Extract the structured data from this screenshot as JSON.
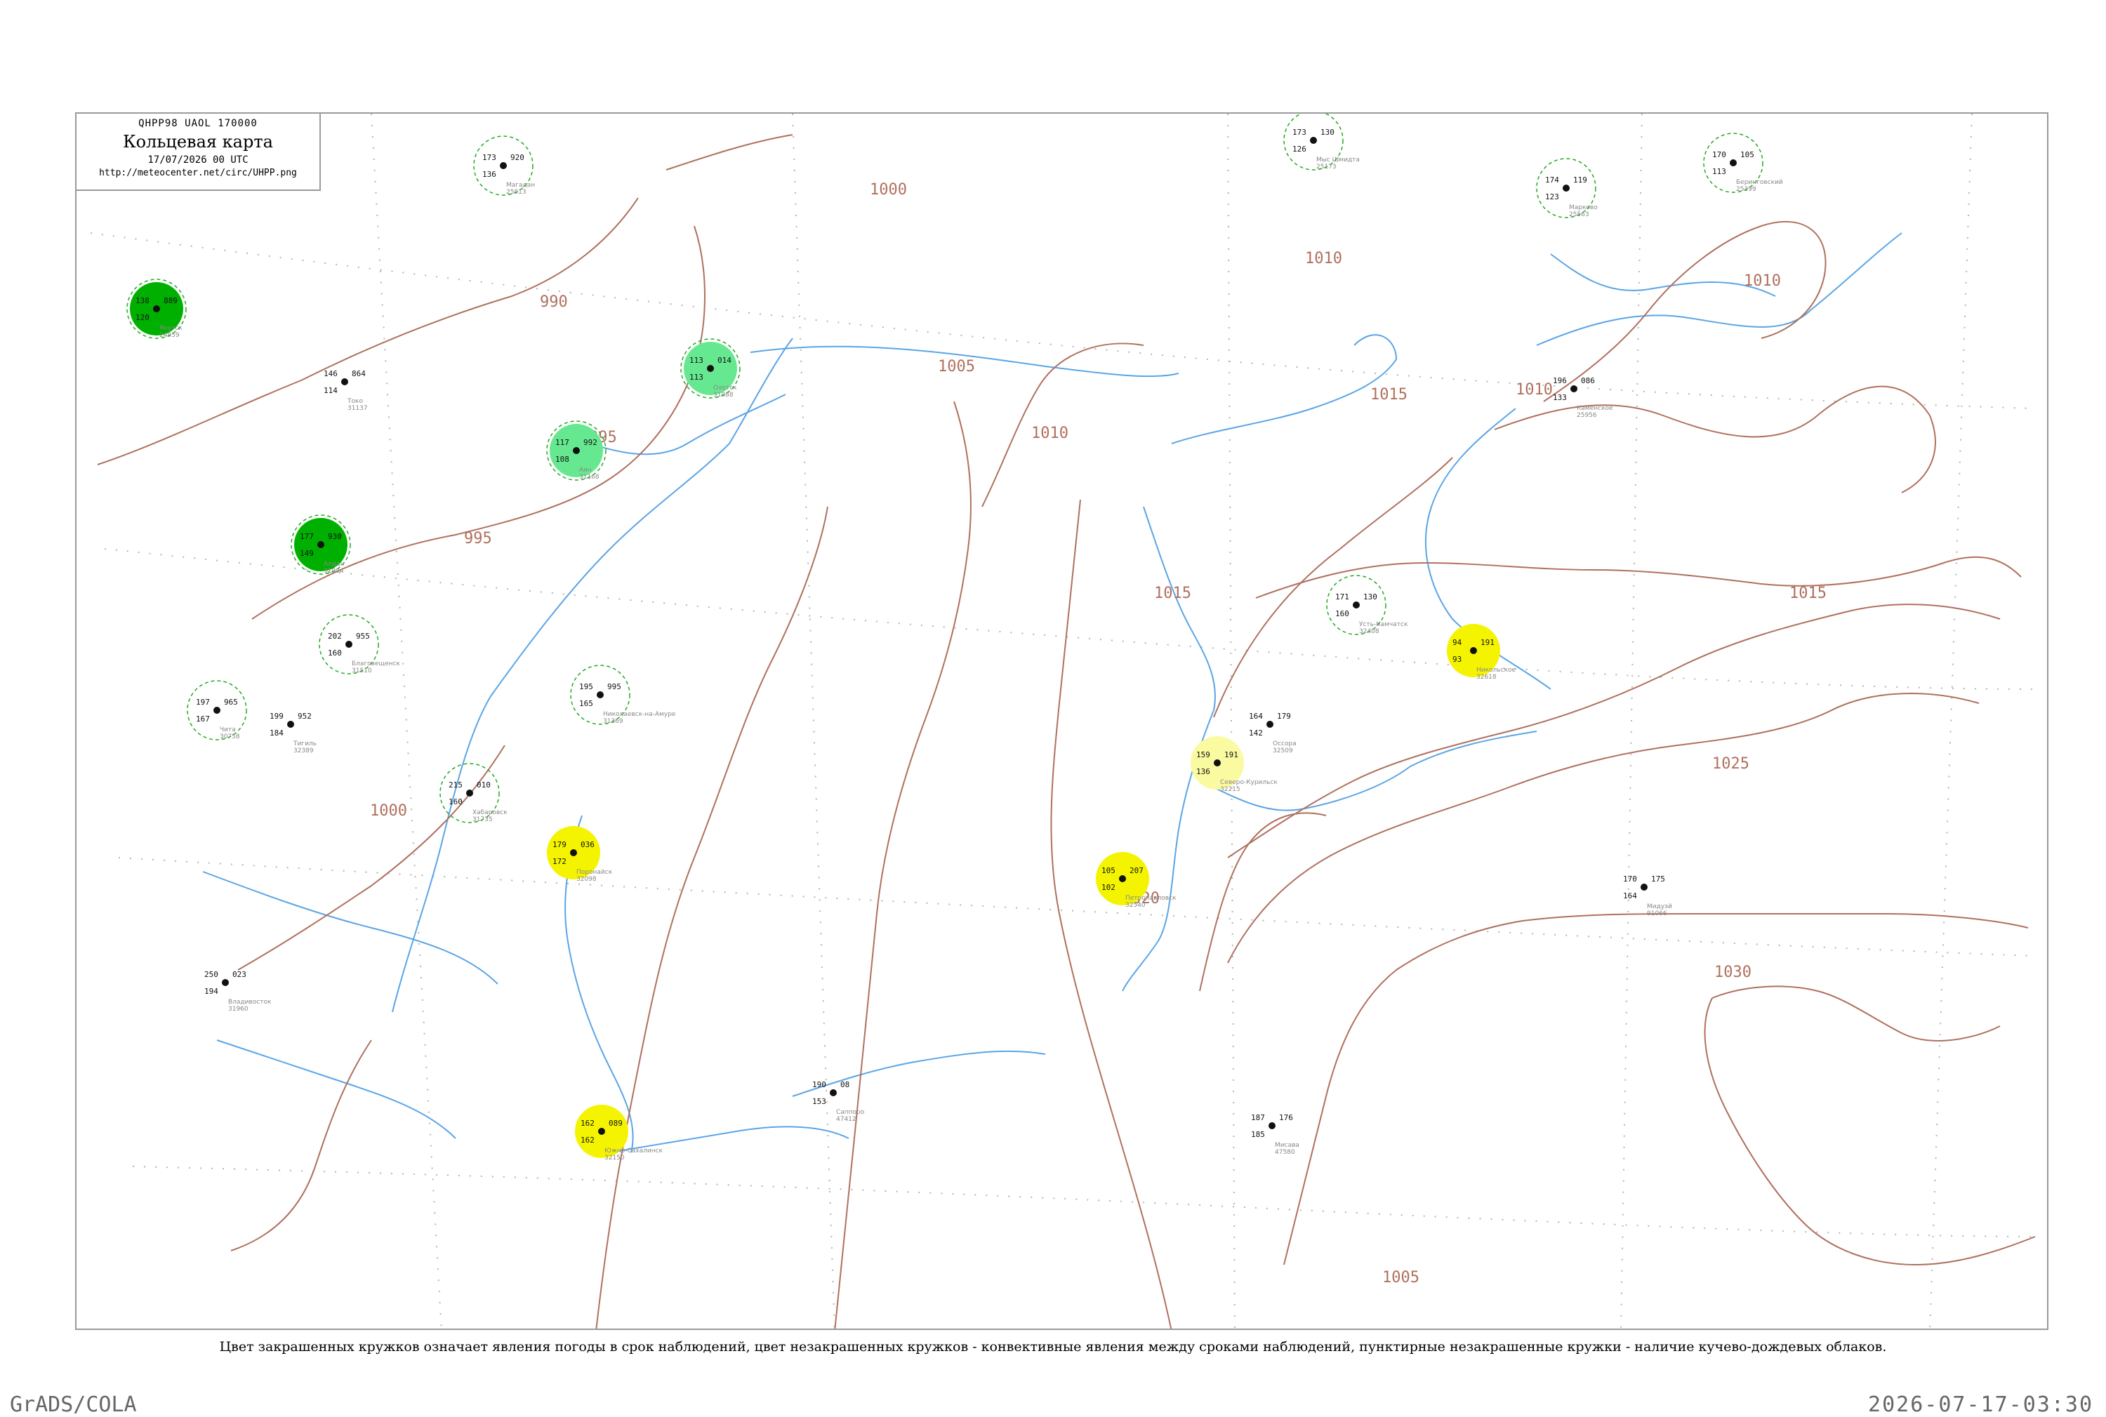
{
  "header": {
    "code": "QHPP98  UAOL  170000",
    "title": "Кольцевая карта",
    "date": "17/07/2026 00 UTC",
    "url": "http://meteocenter.net/circ/UHPP.png"
  },
  "caption": "Цвет закрашенных кружков означает явления погоды в срок наблюдений, цвет незакрашенных кружков - конвективные явления между сроками наблюдений, пунктирные незакрашенные кружки - наличие кучево-дождевых облаков.",
  "footer": {
    "left": "GrADS/COLA",
    "right": "2026-07-17-03:30"
  },
  "colors": {
    "isobar": "#b0705e",
    "river": "#5aa5e6",
    "grid": "#b5b5b5",
    "phenom_dark_green": "#00b000",
    "phenom_light_green": "#66e890",
    "phenom_yellow": "#f4f400",
    "phenom_pale_yellow": "#fafaa0",
    "cb_dashed": "#22aa22"
  },
  "isobar_labels": [
    {
      "text": "990"
    },
    {
      "text": "995"
    },
    {
      "text": "995"
    },
    {
      "text": "1000"
    },
    {
      "text": "1000"
    },
    {
      "text": "1005"
    },
    {
      "text": "1010"
    },
    {
      "text": "1010"
    },
    {
      "text": "1010"
    },
    {
      "text": "1010"
    },
    {
      "text": "1015"
    },
    {
      "text": "1015"
    },
    {
      "text": "1015"
    },
    {
      "text": "1020"
    },
    {
      "text": "1025"
    },
    {
      "text": "1030"
    },
    {
      "text": "1005"
    }
  ],
  "stations": [
    {
      "name": "Тигиль",
      "id": "32389",
      "t": "199",
      "p": "952",
      "d": "184",
      "phenomenon": "none"
    },
    {
      "name": "Усть-Камчатск",
      "id": "32408",
      "t": "171",
      "p": "130",
      "d": "160",
      "phenomenon": "cb"
    },
    {
      "name": "Оссора",
      "id": "32509",
      "t": "164",
      "p": "179",
      "d": "142",
      "phenomenon": "none"
    },
    {
      "name": "Петропавловск",
      "id": "32540",
      "t": "105",
      "p": "207",
      "d": "102",
      "phenomenon": "yellow"
    },
    {
      "name": "Никольское",
      "id": "32618",
      "t": "94",
      "p": "191",
      "d": "93",
      "phenomenon": "yellow"
    },
    {
      "name": "Северо-Курильск",
      "id": "32215",
      "t": "159",
      "p": "191",
      "d": "136",
      "phenomenon": "pale_yellow"
    },
    {
      "name": "Охотск",
      "id": "31088",
      "t": "113",
      "p": "014",
      "d": "113",
      "phenomenon": "light_green"
    },
    {
      "name": "Аян",
      "id": "31168",
      "t": "117",
      "p": "992",
      "d": "108",
      "phenomenon": "light_green"
    },
    {
      "name": "Магадан",
      "id": "25913",
      "t": "173",
      "p": "920",
      "d": "136",
      "phenomenon": "cb"
    },
    {
      "name": "Николаевск-на-Амуре",
      "id": "31369",
      "t": "195",
      "p": "995",
      "d": "165",
      "phenomenon": "cb"
    },
    {
      "name": "Хабаровск",
      "id": "31735",
      "t": "215",
      "p": "010",
      "d": "160",
      "phenomenon": "cb"
    },
    {
      "name": "Южно-Сахалинск",
      "id": "32150",
      "t": "162",
      "p": "089",
      "d": "162",
      "phenomenon": "yellow"
    },
    {
      "name": "Поронайск",
      "id": "32098",
      "t": "179",
      "p": "036",
      "d": "172",
      "phenomenon": "yellow"
    },
    {
      "name": "Владивосток",
      "id": "31960",
      "t": "250",
      "p": "023",
      "d": "194",
      "phenomenon": "none"
    },
    {
      "name": "Благовещенск",
      "id": "31510",
      "t": "202",
      "p": "955",
      "d": "160",
      "phenomenon": "cb"
    },
    {
      "name": "Чита",
      "id": "30758",
      "t": "197",
      "p": "965",
      "d": "167",
      "phenomenon": "cb"
    },
    {
      "name": "Якутск",
      "id": "24959",
      "t": "138",
      "p": "889",
      "d": "120",
      "phenomenon": "dark_green"
    },
    {
      "name": "Алдан",
      "id": "31004",
      "t": "177",
      "p": "930",
      "d": "149",
      "phenomenon": "dark_green"
    },
    {
      "name": "Токо",
      "id": "31137",
      "t": "146",
      "p": "864",
      "d": "114",
      "phenomenon": "none"
    },
    {
      "name": "Саппоро",
      "id": "47412",
      "t": "190",
      "p": "08",
      "d": "153",
      "phenomenon": "none"
    },
    {
      "name": "Мисава",
      "id": "47580",
      "t": "187",
      "p": "176",
      "d": "185",
      "phenomenon": "none"
    },
    {
      "name": "Беринговский",
      "id": "25399",
      "t": "170",
      "p": "105",
      "d": "113",
      "phenomenon": "cb"
    },
    {
      "name": "Марково",
      "id": "25563",
      "t": "174",
      "p": "119",
      "d": "123",
      "phenomenon": "cb"
    },
    {
      "name": "Мыс Шмидта",
      "id": "25173",
      "t": "173",
      "p": "130",
      "d": "126",
      "phenomenon": "cb"
    },
    {
      "name": "Каменское",
      "id": "25956",
      "t": "196",
      "p": "086",
      "d": "133",
      "phenomenon": "none"
    },
    {
      "name": "Мидуэй",
      "id": "91066",
      "t": "170",
      "p": "175",
      "d": "164",
      "phenomenon": "none"
    }
  ]
}
